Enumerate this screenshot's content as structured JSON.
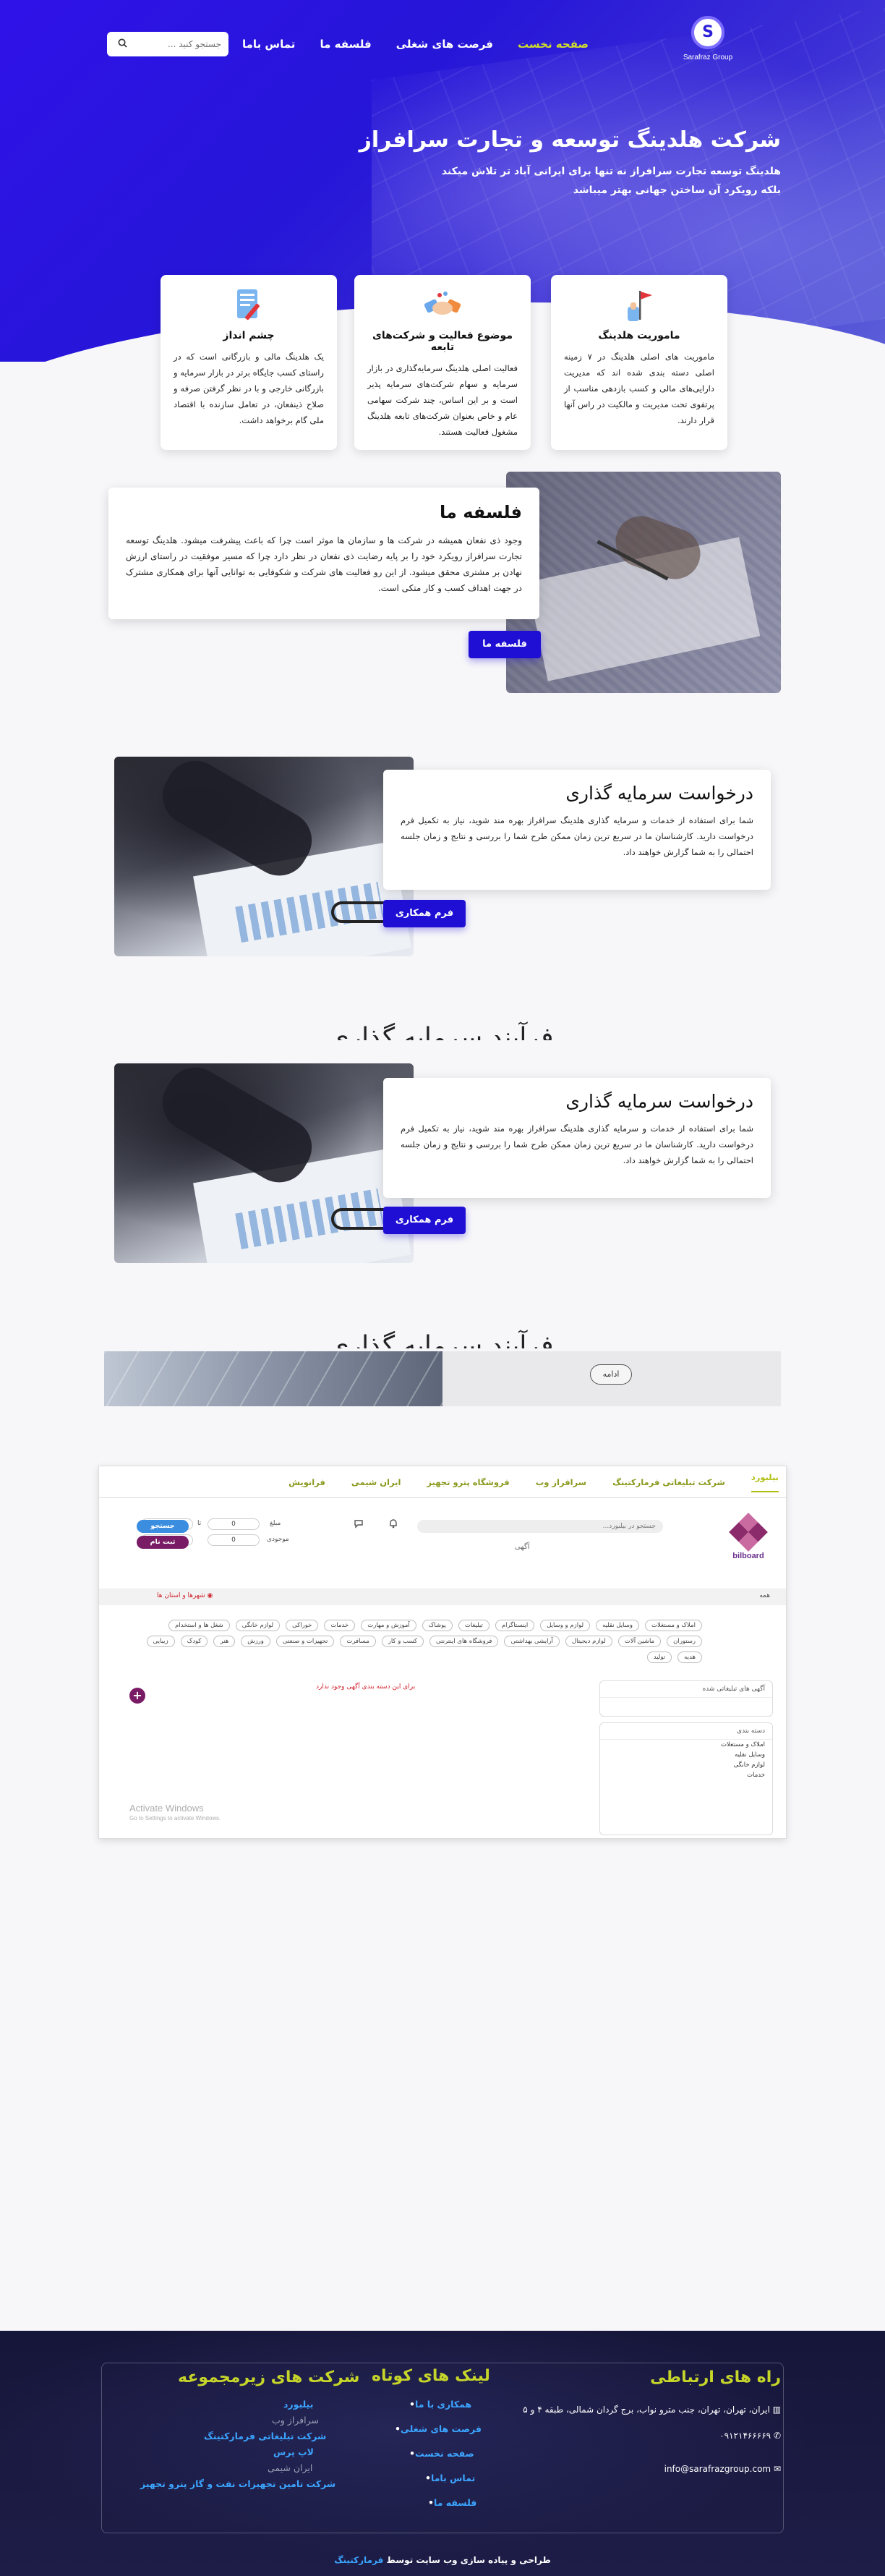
{
  "brand": {
    "logo_letter": "S",
    "logo_text": "Sarafraz Group"
  },
  "nav": {
    "links": [
      "صفحه نخست",
      "فرصت های شغلی",
      "فلسفه ما",
      "تماس باما"
    ],
    "search_placeholder": "جستجو کنید ..."
  },
  "hero": {
    "title": "شرکت هلدینگ توسعه و تجارت سرافراز",
    "subtitle": "هلدینگ توسعه تجارت سرافراز نه تنها برای ایرانی آباد تر تلاش میکند بلکه رویکرد آن ساختن جهانی بهتر میباشد"
  },
  "features": [
    {
      "icon": "flag-icon",
      "title": "ماموریت هلدینگ",
      "text": "ماموریت های اصلی هلدینگ در ۷ زمینه اصلی دسته بندی شده اند که مدیریت دارایی‌های مالی و کسب بازدهی مناسب از پرتفوی تحت مدیریت و مالکیت در راس آنها قرار دارند."
    },
    {
      "icon": "handshake-icon",
      "title": "موضوع فعالیت و شرکت‌های تابعه",
      "text": "فعالیت اصلی هلدینگ سرمایه‌گذاری در بازار سرمایه و سهام شرکت‌های سرمایه پذیر است و بر این اساس، چند شرکت سهامی عام و خاص بعنوان شرکت‌های تابعه هلدینگ مشغول فعالیت هستند."
    },
    {
      "icon": "document-pen-icon",
      "title": "چشم انداز",
      "text": "یک هلدینگ مالی و بازرگانی است که در راستای کسب جایگاه برتر در بازار سرمایه و بازرگانی خارجی و با در نظر گرفتن صرفه و صلاح ذینفعان، در تعامل سازنده با اقتصاد ملی گام برخواهد داشت."
    }
  ],
  "philosophy": {
    "title": "فلسفه ما",
    "text": "وجود ذی نفعان همیشه در شرکت ها و سازمان ها موثر است چرا که باعث پیشرفت میشود. هلدینگ توسعه تجارت سرافراز رویکرد خود را بر پایه رضایت ذی نفعان در نظر دارد چرا که مسیر موفقیت در راستای ارزش نهادن بر مشتری محقق میشود. از این رو فعالیت های شرکت و شکوفایی به توانایی آنها برای همکاری مشترک در جهت اهداف کسب و کار متکی است.",
    "button": "فلسفه ما"
  },
  "investment": {
    "title": "درخواست سرمایه گذاری",
    "text": "شما برای استفاده از خدمات و سرمایه گذاری هلدینگ سرافراز بهره مند شوید، نیاز به تکمیل فرم درخواست دارید. کارشناسان ما در سریع ترین زمان ممکن طرح شما را بررسی و نتایج و زمان جلسه احتمالی را به شما گزارش خواهند داد.",
    "button": "فرم همکاری"
  },
  "process_heading": "فرآیند سرمایه گذاری",
  "banner": {
    "button": "ادامه"
  },
  "shop": {
    "tabs": [
      "بیلبورد",
      "شرکت تبلیغاتی فرمارکتینگ",
      "سرافراز وب",
      "فروشگاه پترو تجهیز",
      "ایران شیمی",
      "فرانویش"
    ],
    "search_placeholder": "جستجو در بیلبورد...",
    "ads_label": "آگهی",
    "logo_text": "bilboard",
    "price_label": "مبلغ",
    "price_to": "تا",
    "type_label": "موجودی",
    "zero": "0",
    "btn_search": "جستجو",
    "btn_submit": "ثبت نام",
    "bar_all": "همه",
    "bar_location": "شهرها و استان ها",
    "chips": [
      "املاک و مستغلات",
      "وسایل نقلیه",
      "لوازم و وسایل",
      "اینستاگرام",
      "تبلیغات",
      "پوشاک",
      "آموزش و مهارت",
      "خدمات",
      "خوراکی",
      "لوازم خانگی",
      "شغل ها و استخدام",
      "رستوران",
      "ماشین آلات",
      "لوازم دیجیتال",
      "آرایشی بهداشتی",
      "فروشگاه های اینترنتی",
      "کسب و کار",
      "مسافرت",
      "تجهیزات و صنعتی",
      "ورزش",
      "هنر",
      "کودک",
      "زیبایی",
      "هدیه",
      "تولید"
    ],
    "note": "برای این دسته بندی آگهی وجود ندارد",
    "side_filter_title": "آگهی های تبلیغاتی شده",
    "side_category_title": "دسته بندی",
    "categories": [
      "املاک و مستغلات",
      "وسایل نقلیه",
      "لوازم خانگی",
      "خدمات"
    ],
    "watermark": "Activate Windows",
    "watermark_sub": "Go to Settings to activate Windows."
  },
  "footer": {
    "contact_title": "راه های ارتباطی",
    "address": "ایران، تهران، تهران، جنب مترو نواب، برج گردان شمالی، طبقه ۴ و ۵",
    "phone": "۰۹۱۲۱۴۶۶۶۶۹",
    "email": "info@sarafrazgroup.com",
    "links_title": "لینک های کوتاه",
    "links": [
      "همکاری با ما",
      "فرصت های شغلی",
      "صفحه نخست",
      "تماس باما",
      "فلسفه ما"
    ],
    "subs_title": "شرکت های زیرمجموعه",
    "subs": [
      "بیلبورد",
      "سرافراز وب",
      "شرکت تبلیغاتی فرمارکتینگ",
      "لاپ پرس",
      "ایران شیمی",
      "شرکت تامین تجهیزات نفت و گاز پترو تجهیز"
    ],
    "copyright_text": "طراحی و پیاده سازی وب سایت توسط",
    "copyright_brand": "فرمارکتینگ"
  }
}
